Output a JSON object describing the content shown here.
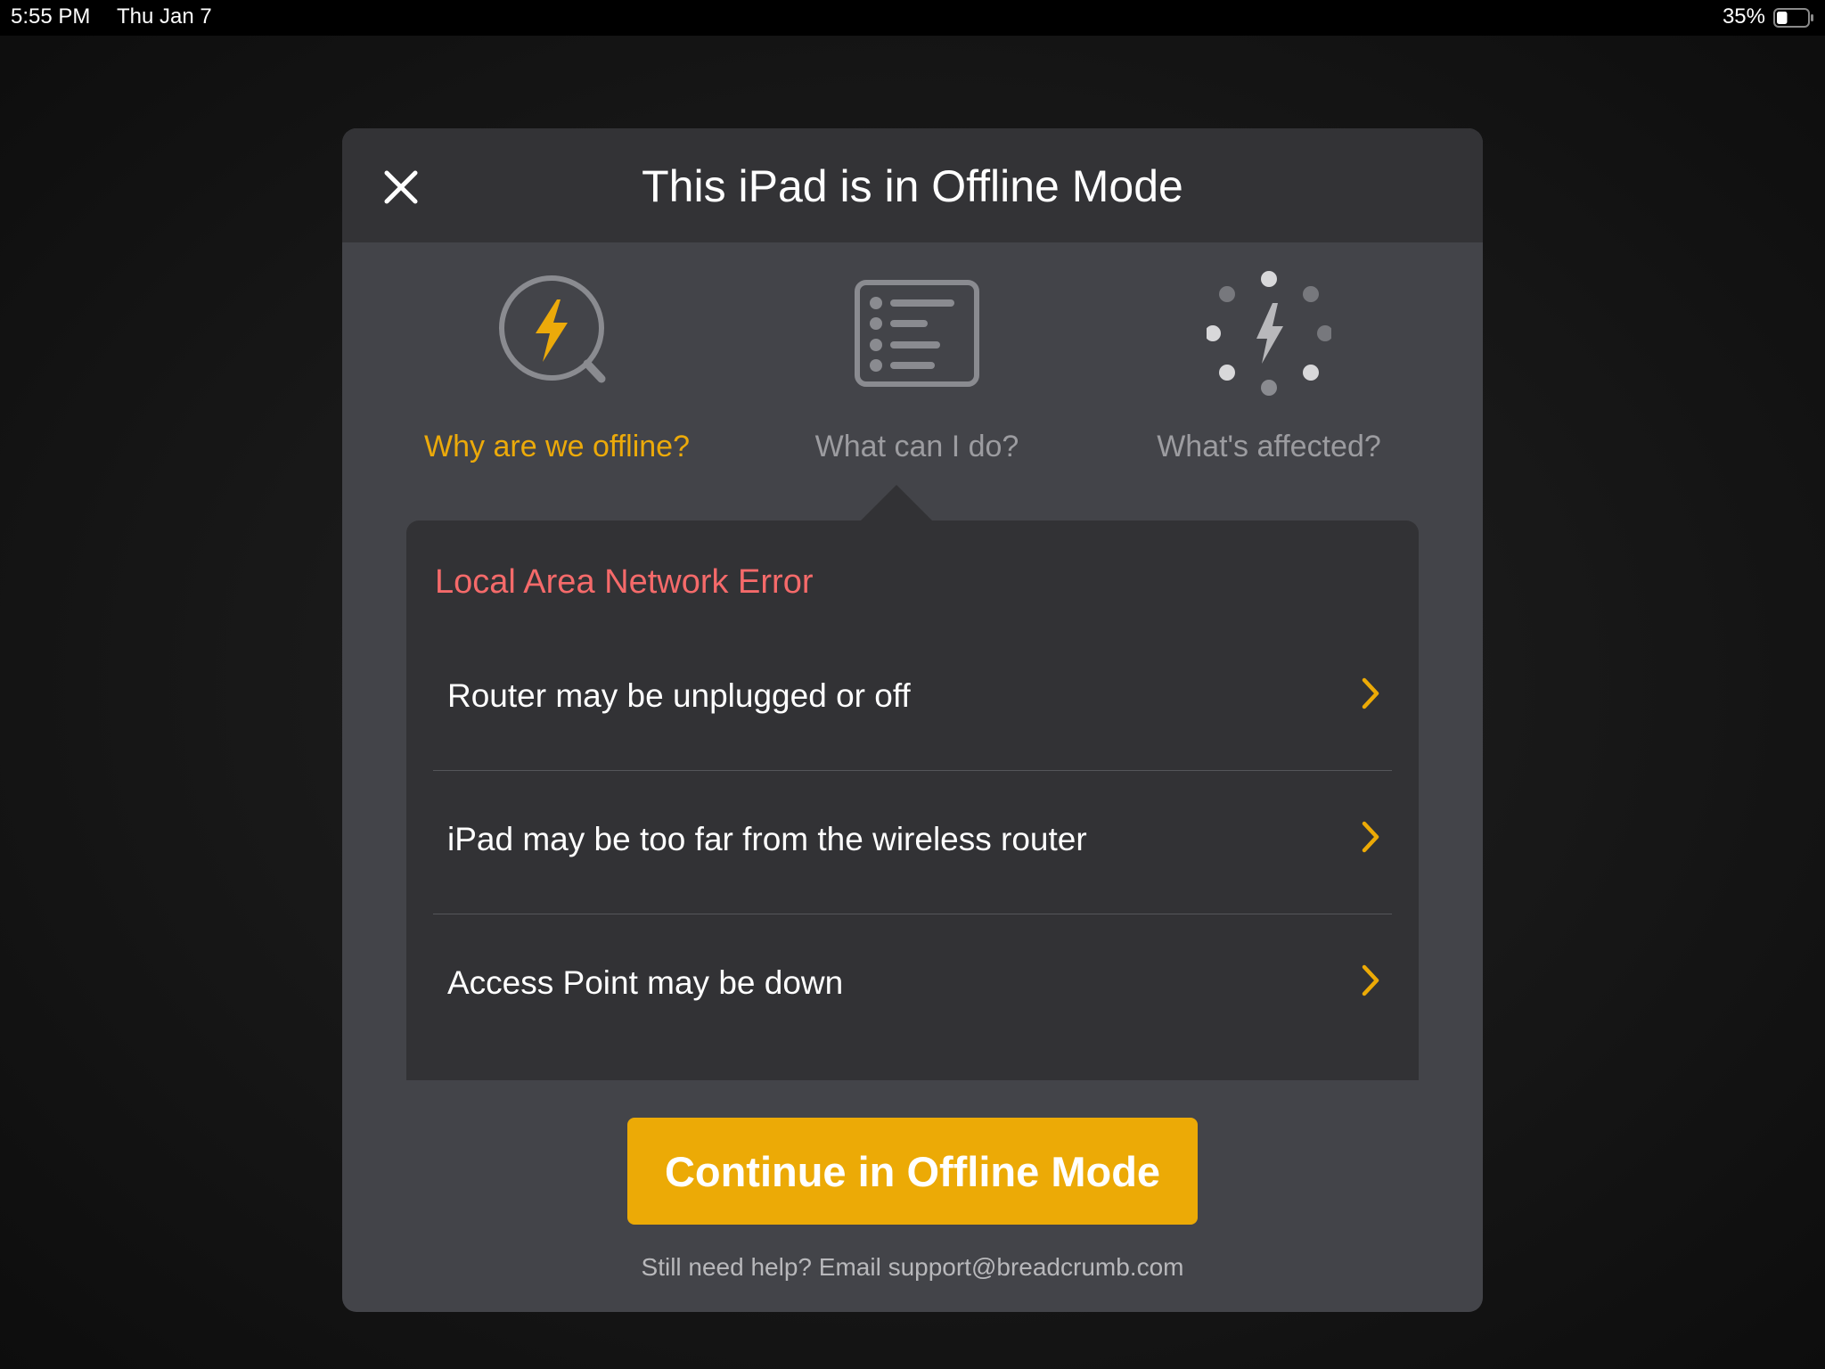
{
  "status_bar": {
    "time": "5:55 PM",
    "date": "Thu Jan 7",
    "battery_percent": "35%",
    "battery_level": 0.35
  },
  "modal": {
    "title": "This iPad is in Offline Mode",
    "close_icon": "close-icon"
  },
  "tabs": [
    {
      "label": "Why are we offline?",
      "icon": "lightning-magnifier-icon",
      "active": true
    },
    {
      "label": "What can I do?",
      "icon": "checklist-icon",
      "active": false
    },
    {
      "label": "What's affected?",
      "icon": "lightning-spinner-icon",
      "active": false
    }
  ],
  "panel": {
    "title": "Local Area Network Error",
    "reasons": [
      {
        "label": "Router may be unplugged or off",
        "icon": "chevron-right-icon"
      },
      {
        "label": "iPad may be too far from the wireless router",
        "icon": "chevron-right-icon"
      },
      {
        "label": "Access Point may be down",
        "icon": "chevron-right-icon"
      }
    ]
  },
  "actions": {
    "continue_label": "Continue in Offline Mode"
  },
  "footer": {
    "help_text": "Still need help? Email support@breadcrumb.com"
  },
  "colors": {
    "accent": "#ecaa06",
    "error": "#f56a6a",
    "modal_bg": "#434449",
    "header_bg": "#333336",
    "panel_bg": "#323235",
    "inactive_text": "#9c9ca0"
  }
}
